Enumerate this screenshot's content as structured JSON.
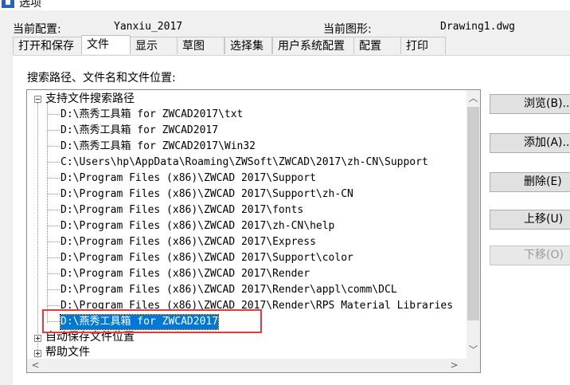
{
  "window": {
    "title": "选项"
  },
  "info": {
    "current_config_label": "当前配置:",
    "current_config_value": "Yanxiu_2017",
    "current_drawing_label": "当前图形:",
    "current_drawing_value": "Drawing1.dwg"
  },
  "tabs": [
    {
      "label": "打开和保存"
    },
    {
      "label": "文件",
      "active": true
    },
    {
      "label": "显示"
    },
    {
      "label": "草图"
    },
    {
      "label": "选择集"
    },
    {
      "label": "用户系统配置"
    },
    {
      "label": "配置"
    },
    {
      "label": "打印"
    }
  ],
  "files": {
    "section_label": "搜索路径、文件名和文件位置:",
    "tree": {
      "node1_label": "支持文件搜索路径",
      "paths": [
        "D:\\燕秀工具箱 for ZWCAD2017\\txt",
        "D:\\燕秀工具箱 for ZWCAD2017",
        "D:\\燕秀工具箱 for ZWCAD2017\\Win32",
        "C:\\Users\\hp\\AppData\\Roaming\\ZWSoft\\ZWCAD\\2017\\zh-CN\\Support",
        "D:\\Program Files (x86)\\ZWCAD 2017\\Support",
        "D:\\Program Files (x86)\\ZWCAD 2017\\Support\\zh-CN",
        "D:\\Program Files (x86)\\ZWCAD 2017\\fonts",
        "D:\\Program Files (x86)\\ZWCAD 2017\\zh-CN\\help",
        "D:\\Program Files (x86)\\ZWCAD 2017\\Express",
        "D:\\Program Files (x86)\\ZWCAD 2017\\Support\\color",
        "D:\\Program Files (x86)\\ZWCAD 2017\\Render",
        "D:\\Program Files (x86)\\ZWCAD 2017\\Render\\appl\\comm\\DCL",
        "D:\\Program Files (x86)\\ZWCAD 2017\\Render\\RPS Material Libraries"
      ],
      "selected_path": "D:\\燕秀工具箱 for ZWCAD2017",
      "node2_label": "自动保存文件位置",
      "node3_label": "帮助文件"
    }
  },
  "buttons": {
    "browse": "浏览(B)...",
    "add": "添加(A)...",
    "delete": "删除(E)",
    "move_up": "上移(U)",
    "move_down": "下移(O)"
  },
  "scrollbar": {
    "up_glyph": "︿",
    "down_glyph": "﹀",
    "left_glyph": "<",
    "right_glyph": ">"
  }
}
